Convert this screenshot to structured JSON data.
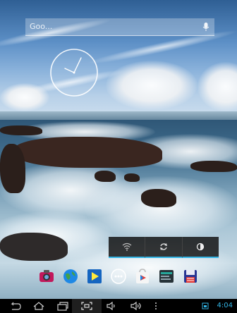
{
  "search": {
    "placeholder": "Goo..."
  },
  "status": {
    "time": "4:04"
  },
  "quick_settings": {
    "items": [
      {
        "name": "wifi",
        "icon": "wifi-icon"
      },
      {
        "name": "sync",
        "icon": "sync-icon"
      },
      {
        "name": "brightness",
        "icon": "brightness-icon"
      }
    ]
  },
  "dock": {
    "icons": [
      "camera-icon",
      "browser-icon",
      "play-movies-icon",
      "app-drawer-icon",
      "play-store-icon",
      "file-manager-icon",
      "save-icon"
    ]
  },
  "navbar": {
    "buttons": [
      "back-icon",
      "home-icon",
      "recent-apps-icon",
      "screenshot-icon",
      "volume-down-icon",
      "volume-up-icon",
      "menu-icon"
    ]
  },
  "colors": {
    "accent": "#33b5e5"
  }
}
